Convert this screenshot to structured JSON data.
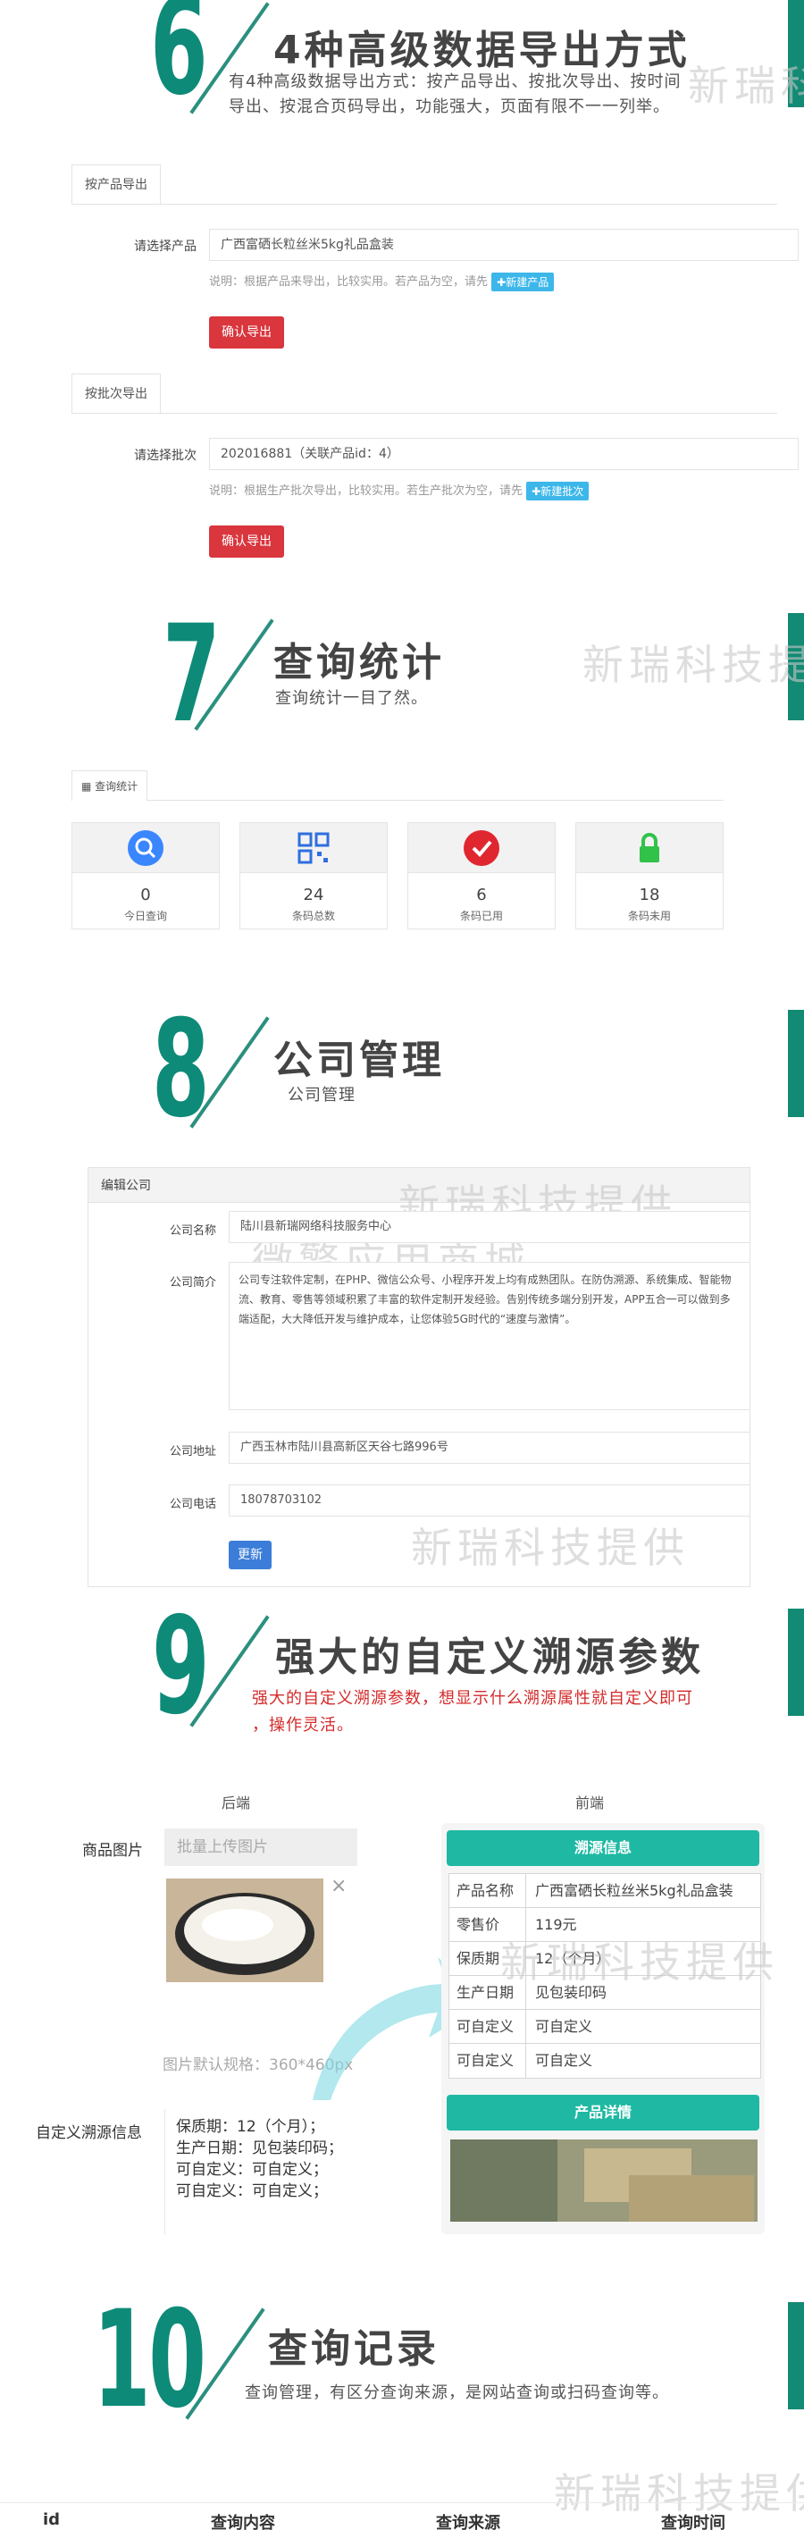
{
  "sections": {
    "s6": {
      "number": "6",
      "title": "4种高级数据导出方式",
      "desc_line1": "有4种高级数据导出方式：按产品导出、按批次导出、按时间",
      "desc_line2": "导出、按混合页码导出，功能强大，页面有限不一一列举。",
      "tab_product": "按产品导出",
      "label_product": "请选择产品",
      "value_product": "广西富硒长粒丝米5kg礼品盒装",
      "hint_product": "说明：根据产品来导出，比较实用。若产品为空，请先",
      "tag_new_product": "新建产品",
      "btn_confirm_1": "确认导出",
      "tab_batch": "按批次导出",
      "label_batch": "请选择批次",
      "value_batch": "202016881（关联产品id：4）",
      "hint_batch": "说明：根据生产批次导出，比较实用。若生产批次为空，请先",
      "tag_new_batch": "新建批次",
      "btn_confirm_2": "确认导出"
    },
    "s7": {
      "number": "7",
      "title": "查询统计",
      "desc": "查询统计一目了然。",
      "tab": "查询统计",
      "cards": [
        {
          "value": "0",
          "label": "今日查询"
        },
        {
          "value": "24",
          "label": "条码总数"
        },
        {
          "value": "6",
          "label": "条码已用"
        },
        {
          "value": "18",
          "label": "条码未用"
        }
      ]
    },
    "s8": {
      "number": "8",
      "title": "公司管理",
      "desc": "公司管理",
      "panel_title": "编辑公司",
      "name_label": "公司名称",
      "name_value": "陆川县新瑞网络科技服务中心",
      "intro_label": "公司简介",
      "intro_value": "公司专注软件定制，在PHP、微信公众号、小程序开发上均有成熟团队。在防伪溯源、系统集成、智能物流、教育、零售等领域积累了丰富的软件定制开发经验。告别传统多端分别开发，APP五合一可以做到多端适配，大大降低开发与维护成本，让您体验5G时代的“速度与激情”。",
      "addr_label": "公司地址",
      "addr_value": "广西玉林市陆川县高新区天谷七路996号",
      "phone_label": "公司电话",
      "phone_value": "18078703102",
      "btn_update": "更新"
    },
    "s9": {
      "number": "9",
      "title": "强大的自定义溯源参数",
      "desc_line1": "强大的自定义溯源参数，想显示什么溯源属性就自定义即可",
      "desc_line2": "，操作灵活。",
      "col_backend": "后端",
      "col_frontend": "前端",
      "img_label": "商品图片",
      "upload_btn": "批量上传图片",
      "close_mark": "×",
      "img_spec": "图片默认规格：360*460px",
      "custom_label": "自定义溯源信息",
      "custom_lines": [
        "保质期：12（个月）；",
        "生产日期：见包装印码；",
        "可自定义：可自定义；",
        "可自定义：可自定义；"
      ],
      "trace_head": "溯源信息",
      "trace_rows": [
        {
          "k": "产品名称",
          "v": "广西富硒长粒丝米5kg礼品盒装"
        },
        {
          "k": "零售价",
          "v": "119元"
        },
        {
          "k": "保质期",
          "v": "12（个月）"
        },
        {
          "k": "生产日期",
          "v": "见包装印码"
        },
        {
          "k": "可自定义",
          "v": "可自定义"
        },
        {
          "k": "可自定义",
          "v": "可自定义"
        }
      ],
      "detail_head": "产品详情"
    },
    "s10": {
      "number": "10",
      "title": "查询记录",
      "desc": "查询管理，有区分查询来源，是网站查询或扫码查询等。",
      "columns": [
        "id",
        "查询内容",
        "查询来源",
        "查询时间"
      ]
    }
  },
  "watermarks": {
    "brand": "新瑞科技提供",
    "shop": "微擎应用商城"
  },
  "colors": {
    "teal": "#0e8a78",
    "teal_head": "#1fb9a3",
    "red": "#d9363e",
    "blue_tag": "#3db7ea"
  }
}
